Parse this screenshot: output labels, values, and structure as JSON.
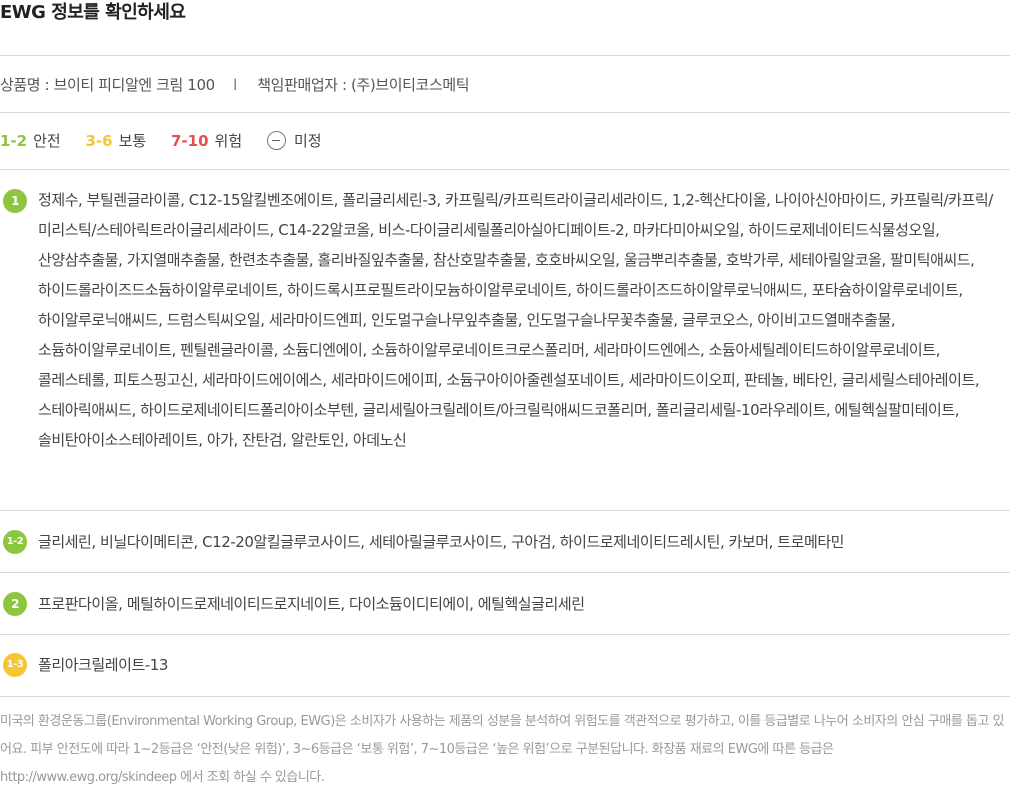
{
  "title": "EWG 정보를 확인하세요",
  "product": {
    "name_label": "상품명 : 브이티 피디알엔 크림 100",
    "separator": "l",
    "seller_label": "책임판매업자 : (주)브이티코스메틱"
  },
  "legend": {
    "safe_num": "1-2",
    "safe_label": "안전",
    "normal_num": "3-6",
    "normal_label": "보통",
    "danger_num": "7-10",
    "danger_label": "위험",
    "undefined_label": "미정",
    "colors": {
      "safe": "#8cc63f",
      "normal": "#f7c534",
      "danger": "#e94e4e"
    }
  },
  "groups": [
    {
      "grade": "1",
      "color": "green",
      "ingredients": "정제수, 부틸렌글라이콜, C12-15알킬벤조에이트, 폴리글리세린-3, 카프릴릭/카프릭트라이글리세라이드, 1,2-헥산다이올, 나이아신아마이드, 카프릴릭/카프릭/미리스틱/스테아릭트라이글리세라이드, C14-22알코올, 비스-다이글리세릴폴리아실아디페이트-2, 마카다미아씨오일, 하이드로제네이티드식물성오일, 산양삼추출물, 가지열매추출물, 한련초추출물, 홀리바질잎추출물, 참산호말추출물, 호호바씨오일, 울금뿌리추출물, 호박가루, 세테아릴알코올, 팔미틱애씨드, 하이드롤라이즈드소듐하이알루로네이트, 하이드록시프로필트라이모늄하이알루로네이트, 하이드롤라이즈드하이알루로닉애씨드, 포타슘하이알루로네이트, 하이알루로닉애씨드, 드럼스틱씨오일, 세라마이드엔피, 인도멀구슬나무잎추출물, 인도멀구슬나무꽃추출물, 글루코오스, 아이비고드열매추출물, 소듐하이알루로네이트, 펜틸렌글라이콜, 소듐디엔에이, 소듐하이알루로네이트크로스폴리머, 세라마이드엔에스, 소듐아세틸레이티드하이알루로네이트, 콜레스테롤, 피토스핑고신, 세라마이드에이에스, 세라마이드에이피, 소듐구아이아줄렌설포네이트, 세라마이드이오피, 판테놀, 베타인, 글리세릴스테아레이트, 스테아릭애씨드, 하이드로제네이티드폴리아이소부텐, 글리세릴아크릴레이트/아크릴릭애씨드코폴리머, 폴리글리세릴-10라우레이트, 에틸헥실팔미테이트, 솔비탄아이소스테아레이트, 아가, 잔탄검, 알란토인, 아데노신"
    },
    {
      "grade": "1-2",
      "color": "green",
      "ingredients": "글리세린, 비닐다이메티콘, C12-20알킬글루코사이드, 세테아릴글루코사이드, 구아검, 하이드로제네이티드레시틴, 카보머, 트로메타민"
    },
    {
      "grade": "2",
      "color": "green",
      "ingredients": "프로판다이올, 메틸하이드로제네이티드로지네이트, 다이소듐이디티에이, 에틸헥실글리세린"
    },
    {
      "grade": "1-3",
      "color": "yellow",
      "ingredients": "폴리아크릴레이트-13"
    }
  ],
  "note": "미국의 환경운동그룹(Environmental Working Group, EWG)은 소비자가 사용하는 제품의 성분을 분석하여 위험도를 객관적으로 평가하고, 이를 등급별로 나누어 소비자의 안심 구매를 돕고 있어요. 피부 안전도에 따라 1~2등급은 ‘안전(낮은 위험)’, 3~6등급은 ‘보통 위험’, 7~10등급은 ‘높은 위험’으로 구분된답니다. 화장품 재료의 EWG에 따른 등급은 http://www.ewg.org/skindeep 에서 조회 하실 수 있습니다."
}
